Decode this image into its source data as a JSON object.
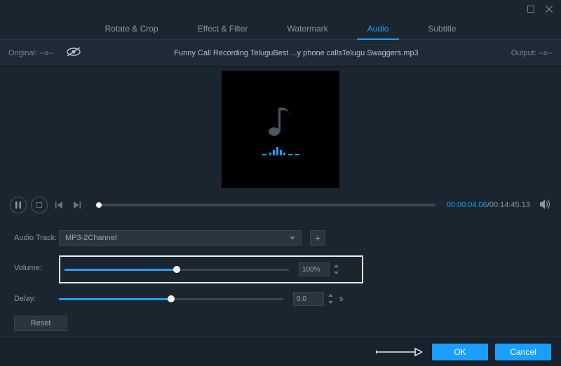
{
  "window": {
    "maximize_tooltip": "Maximize",
    "close_tooltip": "Close"
  },
  "tabs": [
    {
      "label": "Rotate & Crop",
      "active": false
    },
    {
      "label": "Effect & Filter",
      "active": false
    },
    {
      "label": "Watermark",
      "active": false
    },
    {
      "label": "Audio",
      "active": true
    },
    {
      "label": "Subtitle",
      "active": false
    }
  ],
  "infoBar": {
    "originalLabel": "Original:",
    "originalValue": "--x--",
    "filename": "Funny Call Recording TeluguBest ...y phone callsTelugu Swaggers.mp3",
    "outputLabel": "Output:",
    "outputValue": "--x--"
  },
  "playback": {
    "currentTime": "00:00:04.06",
    "totalTime": "00:14:45.13",
    "progressPercent": 0.5
  },
  "controls": {
    "audioTrack": {
      "label": "Audio Track:",
      "value": "MP3-2Channel"
    },
    "volume": {
      "label": "Volume:",
      "value": "100%",
      "percent": 50
    },
    "delay": {
      "label": "Delay:",
      "value": "0.0",
      "percent": 50,
      "unit": "s"
    },
    "resetLabel": "Reset"
  },
  "footer": {
    "okLabel": "OK",
    "cancelLabel": "Cancel"
  }
}
